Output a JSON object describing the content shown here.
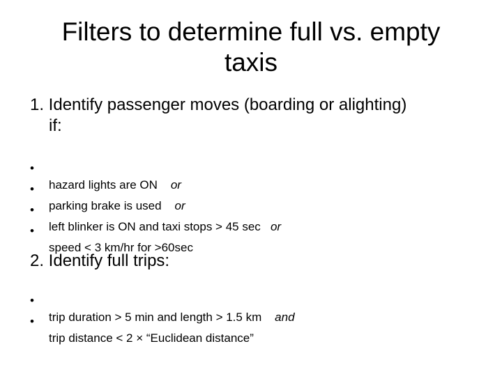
{
  "slide": {
    "title_line1": "Filters to determine full vs. empty",
    "title_line2": "taxis",
    "section1": {
      "heading_line1": "1. Identify passenger moves (boarding or alighting)",
      "heading_line2": "if:",
      "bullets": [
        {
          "text": "hazard lights are ON",
          "connector": "or"
        },
        {
          "text": "parking brake is used",
          "connector": "or"
        },
        {
          "text": "left blinker is ON and taxi stops > 45 sec",
          "connector": "or"
        },
        {
          "text": "speed < 3 km/hr for >60sec",
          "connector": ""
        }
      ]
    },
    "section2": {
      "heading": "2. Identify full trips:",
      "bullets": [
        {
          "text": "trip duration > 5 min and length > 1.5 km",
          "connector": "and"
        },
        {
          "text": "trip distance < 2 × “Euclidean distance”",
          "connector": ""
        }
      ]
    },
    "bullet_glyph": "•"
  }
}
